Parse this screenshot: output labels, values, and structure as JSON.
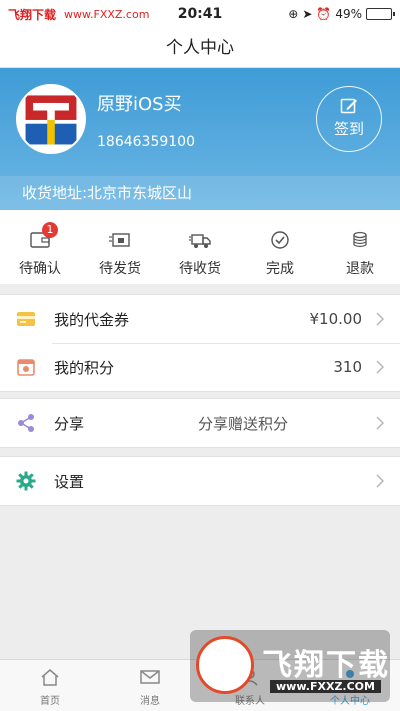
{
  "status_bar": {
    "carrier": "飞翔下载",
    "site": "www.FXXZ.com",
    "time": "20:41",
    "battery": "49%",
    "battery_level": 0.49
  },
  "nav": {
    "title": "个人中心"
  },
  "profile": {
    "username": "原野iOS买",
    "phone": "18646359100",
    "signin_label": "签到",
    "address": "收货地址:北京市东城区山"
  },
  "orders": [
    {
      "label": "待确认",
      "icon": "wallet-icon",
      "badge": "1"
    },
    {
      "label": "待发货",
      "icon": "package-icon"
    },
    {
      "label": "待收货",
      "icon": "truck-icon"
    },
    {
      "label": "完成",
      "icon": "check-circle-icon"
    },
    {
      "label": "退款",
      "icon": "coins-icon"
    }
  ],
  "menu": {
    "voucher": {
      "label": "我的代金券",
      "value": "¥10.00",
      "icon": "voucher-icon",
      "color": "#f5c244"
    },
    "points": {
      "label": "我的积分",
      "value": "310",
      "icon": "points-icon",
      "color": "#ec8b6b"
    },
    "share": {
      "label": "分享",
      "value": "分享赠送积分",
      "icon": "share-icon",
      "color": "#9b8ad6"
    },
    "settings": {
      "label": "设置",
      "icon": "gear-icon",
      "color": "#2aa889"
    }
  },
  "tabbar": [
    {
      "label": "首页",
      "icon": "home-icon"
    },
    {
      "label": "消息",
      "icon": "message-icon"
    },
    {
      "label": "联系人",
      "icon": "contacts-icon"
    },
    {
      "label": "个人中心",
      "icon": "person-icon",
      "active": true
    }
  ],
  "watermark": {
    "title": "飞翔下载",
    "url": "www.FXXZ.COM"
  },
  "colors": {
    "accent": "#3aa0dc",
    "header": "#3f9cd6",
    "badge": "#e53935"
  }
}
